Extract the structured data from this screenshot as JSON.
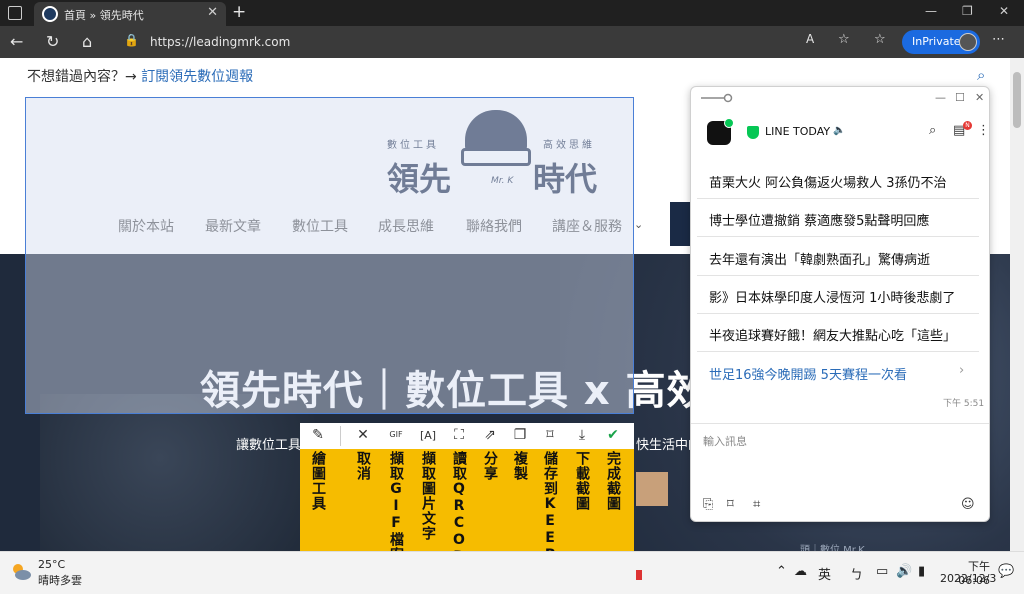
{
  "browser": {
    "tab_title": "首頁 » 領先時代",
    "tab_close": "✕",
    "new_tab": "+",
    "url": "https://leadingmrk.com",
    "inprivate_label": "InPrivate",
    "window_controls": [
      "—",
      "❐",
      "✕"
    ]
  },
  "page": {
    "subscribe_text": "不想錯過內容？→ ",
    "subscribe_link": "訂閱領先數位週報",
    "logo": {
      "tagline_left": "數位工具",
      "tagline_right": "高效思維",
      "name_left": "領先",
      "name_right": "時代",
      "mark": "Mr. K"
    },
    "nav": [
      "關於本站",
      "最新文章",
      "數位工具",
      "成長思維",
      "聯絡我們",
      "講座＆服務"
    ],
    "hero_title": "領先時代｜數位工具 x 高效",
    "hero_sub_left": "讓數位工具",
    "hero_sub_right": "快生活中的",
    "hero_watermark": "頭｜數位 Mr.K"
  },
  "snip_toolbar": {
    "items": [
      {
        "icon": "brush-icon",
        "glyph": "🖌",
        "label": "繪圖工具"
      },
      {
        "icon": "close-icon",
        "glyph": "✕",
        "label": "取消"
      },
      {
        "icon": "gif-icon",
        "glyph": "GIF",
        "label": "擷取GIF檔案"
      },
      {
        "icon": "ocr-text-icon",
        "glyph": "A",
        "label": "擷取圖片文字"
      },
      {
        "icon": "qrcode-scan-icon",
        "glyph": "⛶",
        "label": "讀取QRCODE"
      },
      {
        "icon": "share-icon",
        "glyph": "⇗",
        "label": "分享"
      },
      {
        "icon": "copy-icon",
        "glyph": "❐",
        "label": "複製"
      },
      {
        "icon": "bookmark-icon",
        "glyph": "🔖",
        "label": "儲存到KEEP"
      },
      {
        "icon": "download-icon",
        "glyph": "⤓",
        "label": "下載截圖"
      },
      {
        "icon": "check-icon",
        "glyph": "✔",
        "label": "完成截圖"
      }
    ],
    "accent_color": "#f6bc00"
  },
  "line_panel": {
    "title": "LINE TODAY",
    "badge": "N",
    "news": [
      "苗栗大火 阿公負傷返火場救人 3孫仍不治",
      "博士學位遭撤銷 蔡適應發5點聲明回應",
      "去年還有演出「韓劇熟面孔」驚傳病逝",
      "影》日本妹學印度人浸恆河 1小時後悲劇了",
      "半夜追球賽好餓！網友大推點心吃「這些」"
    ],
    "news_more": "世足16強今晚開踢 5天賽程一次看",
    "time": "下午 5:51",
    "input_placeholder": "輸入訊息",
    "brand_color": "#06c755"
  },
  "taskbar": {
    "temperature": "25°C",
    "weather": "晴時多雲",
    "ime": "英",
    "time": "下午 06:06",
    "date": "2022/12/3"
  }
}
